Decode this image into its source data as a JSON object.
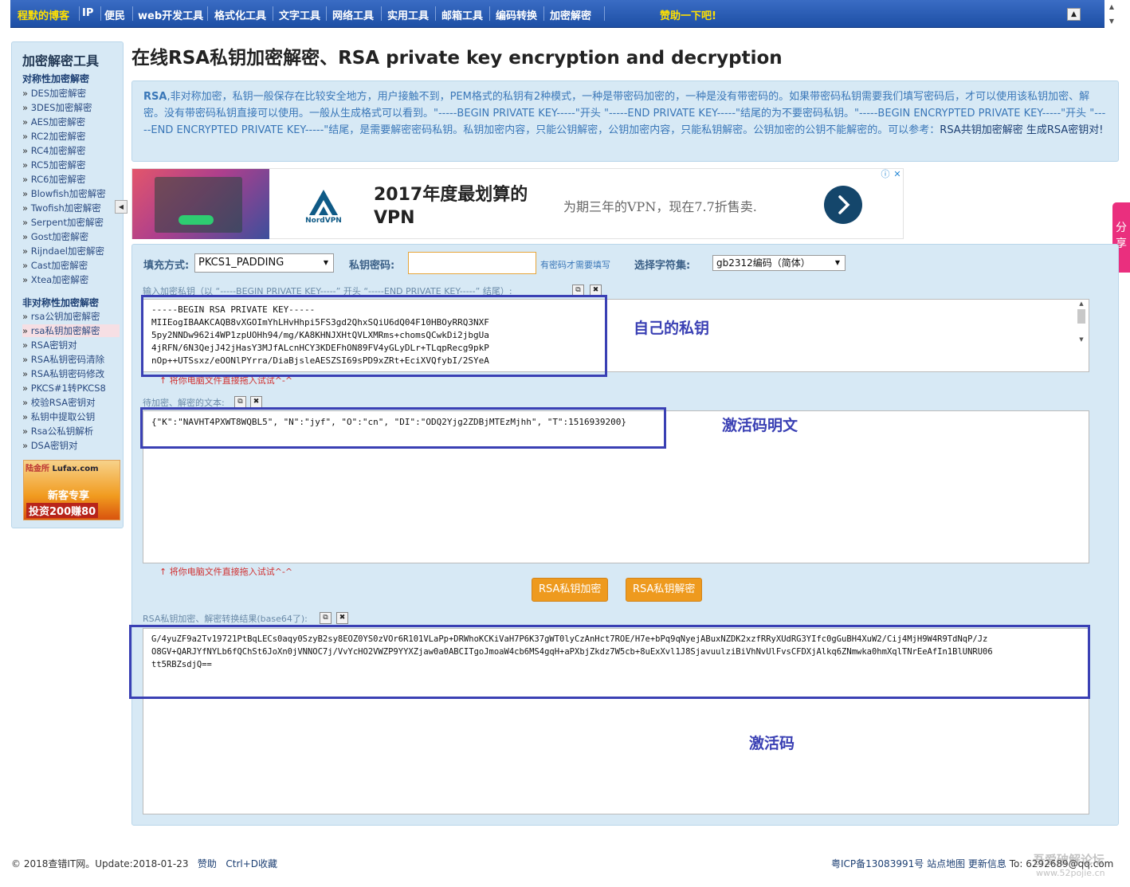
{
  "nav": {
    "brand": "程默的博客",
    "items": [
      "IP",
      "便民",
      "web开发工具",
      "格式化工具",
      "文字工具",
      "网络工具",
      "实用工具",
      "邮箱工具",
      "编码转换",
      "加密解密"
    ],
    "sponsor": "赞助一下吧!",
    "scroll_up": "▲"
  },
  "sidebar": {
    "title": "加密解密工具",
    "symmetric_title": "对称性加密解密",
    "symmetric": [
      "DES加密解密",
      "3DES加密解密",
      "AES加密解密",
      "RC2加密解密",
      "RC4加密解密",
      "RC5加密解密",
      "RC6加密解密",
      "Blowfish加密解密",
      "Twofish加密解密",
      "Serpent加密解密",
      "Gost加密解密",
      "Rijndael加密解密",
      "Cast加密解密",
      "Xtea加密解密"
    ],
    "asymmetric_title": "非对称性加密解密",
    "asymmetric": [
      "rsa公钥加密解密",
      "rsa私钥加密解密",
      "RSA密钥对",
      "RSA私钥密码清除",
      "RSA私钥密码修改",
      "PKCS#1转PKCS8",
      "校验RSA密钥对",
      "私钥中提取公钥",
      "Rsa公私钥解析",
      "DSA密钥对"
    ],
    "ad": {
      "brand_cn": "陆金所",
      "brand_en": "Lufax.com",
      "line1": "新客专享",
      "line2": "投资200赚80"
    }
  },
  "page": {
    "title": "在线RSA私钥加密解密、RSA private key encryption and decryption"
  },
  "intro": {
    "lead": "RSA",
    "body": ",非对称加密，私钥一般保存在比较安全地方，用户接触不到，PEM格式的私钥有2种模式，一种是带密码加密的，一种是没有带密码的。如果带密码私钥需要我们填写密码后，才可以使用该私钥加密、解密。没有带密码私钥直接可以使用。一般从生成格式可以看到。\"-----BEGIN PRIVATE KEY-----\"开头 \"-----END PRIVATE KEY-----\"结尾的为不要密码私钥。\"-----BEGIN ENCRYPTED PRIVATE KEY-----\"开头 \"-----END ENCRYPTED PRIVATE KEY-----\"结尾，是需要解密密码私钥。私钥加密内容，只能公钥解密，公钥加密内容，只能私钥解密。公钥加密的公钥不能解密的。可以参考：",
    "link1": "RSA共钥加密解密",
    "link2": "生成RSA密钥对!"
  },
  "ad": {
    "brand": "NordVPN",
    "headline": "2017年度最划算的VPN",
    "sub": "为期三年的VPN，现在7.7折售卖.",
    "info": "ⓘ",
    "close": "✕"
  },
  "share": {
    "label": "分享"
  },
  "tool": {
    "padding_label": "填充方式:",
    "padding_value": "PKCS1_PADDING",
    "pwd_label": "私钥密码:",
    "pwd_value": "",
    "pwd_hint": "有密码才需要填写",
    "charset_label": "选择字符集:",
    "charset_value": "gb2312编码（简体）",
    "key_label": "输入加密私钥（以 “-----BEGIN PRIVATE KEY-----” 开头 “-----END PRIVATE KEY-----” 结尾）:",
    "key_text": "-----BEGIN RSA PRIVATE KEY-----\nMIIEogIBAAKCAQB8vXGOImYhLHvHhpi5FS3gd2QhxSQiU6dQ04F10HBOyRRQ3NXF\n5py2NNDw962i4WP1zpUOHh94/mg/KA8KHNJXHtQVLXMRms+chomsQCwkDi2jbgUa\n4jRFN/6N3QejJ42jHasY3MJfALcnHCY3KDEFhON89FV4yGLyDLr+TLqpRecg9pkP\nnOp++UTSsxz/eOONlPYrra/DiaBjsleAESZSI69sPD9xZRt+EciXVQfybI/2SYeA",
    "drag_tip": "↑ 将你电脑文件直接拖入试试^-^",
    "text_label": "待加密、解密的文本:",
    "text_value": "{\"K\":\"NAVHT4PXWT8WQBL5\", \"N\":\"jyf\", \"O\":\"cn\", \"DI\":\"ODQ2Yjg2ZDBjMTEzMjhh\", \"T\":1516939200}",
    "encrypt_btn": "RSA私钥加密",
    "decrypt_btn": "RSA私钥解密",
    "result_label": "RSA私钥加密、解密转换结果(base64了):",
    "result_text": "G/4yuZF9a2Tv19721PtBqLECs0aqy0SzyB2sy8EOZ0YS0zVOr6R101VLaPp+DRWhoKCKiVaH7P6K37gWT0lyCzAnHct7ROE/H7e+bPq9qNyejABuxNZDK2xzfRRyXUdRG3YIfc0gGuBH4XuW2/Cij4MjH9W4R9TdNqP/Jz\nO8GV+QARJYfNYLb6fQChSt6JoXn0jVNNOC7j/VvYcHO2VWZP9YYXZjaw0a0ABCITgoJmoaW4cb6MS4gqH+aPXbjZkdz7W5cb+8uExXvl1J8SjavuulziBiVhNvUlFvsCFDXjAlkq6ZNmwka0hmXqlTNrEeAfIn1BlUNRU06\ntt5RBZsdjQ=="
  },
  "annotations": {
    "private_key": "自己的私钥",
    "plaintext": "激活码明文",
    "activation_code": "激活码"
  },
  "footer": {
    "copyright": "© 2018查错IT网。Update:2018-01-23",
    "donate": "赞助",
    "bookmark": "Ctrl+D收藏",
    "icp": "粤ICP备13083991号",
    "sitemap": "站点地图",
    "updates": "更新信息",
    "to": "To: 6292689@qq.com"
  },
  "watermark": {
    "line1": "吾爱破解论坛",
    "line2": "www.52pojie.cn"
  }
}
